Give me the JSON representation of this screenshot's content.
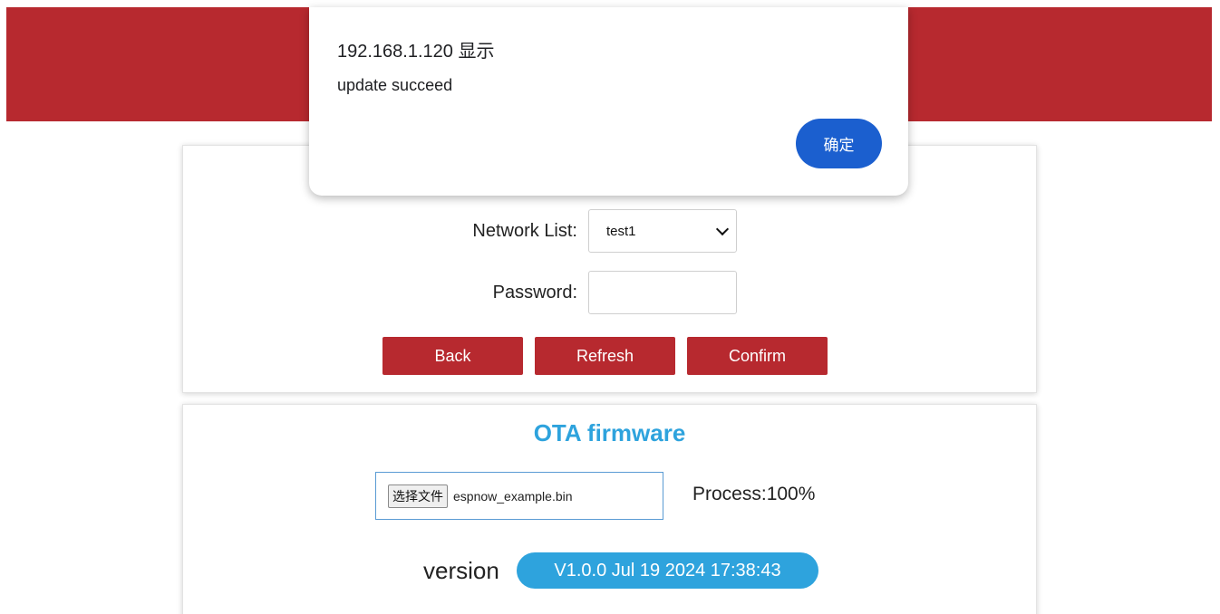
{
  "header": {
    "accent_color": "#b7292f"
  },
  "wifi_form": {
    "network_label": "Network List:",
    "network_selected": "test1",
    "password_label": "Password:",
    "password_value": "",
    "back_label": "Back",
    "refresh_label": "Refresh",
    "confirm_label": "Confirm",
    "button_color": "#b7292f"
  },
  "ota": {
    "title": "OTA firmware",
    "file_button_label": "选择文件",
    "file_name": "espnow_example.bin",
    "process_text": "Process:100%",
    "process_percent": 100,
    "version_label": "version",
    "version_value": "V1.0.0 Jul 19 2024 17:38:43",
    "accent_color": "#2ea3dd"
  },
  "dialog": {
    "title": "192.168.1.120 显示",
    "message": "update succeed",
    "ok_label": "确定",
    "button_color": "#1b5fcf"
  }
}
